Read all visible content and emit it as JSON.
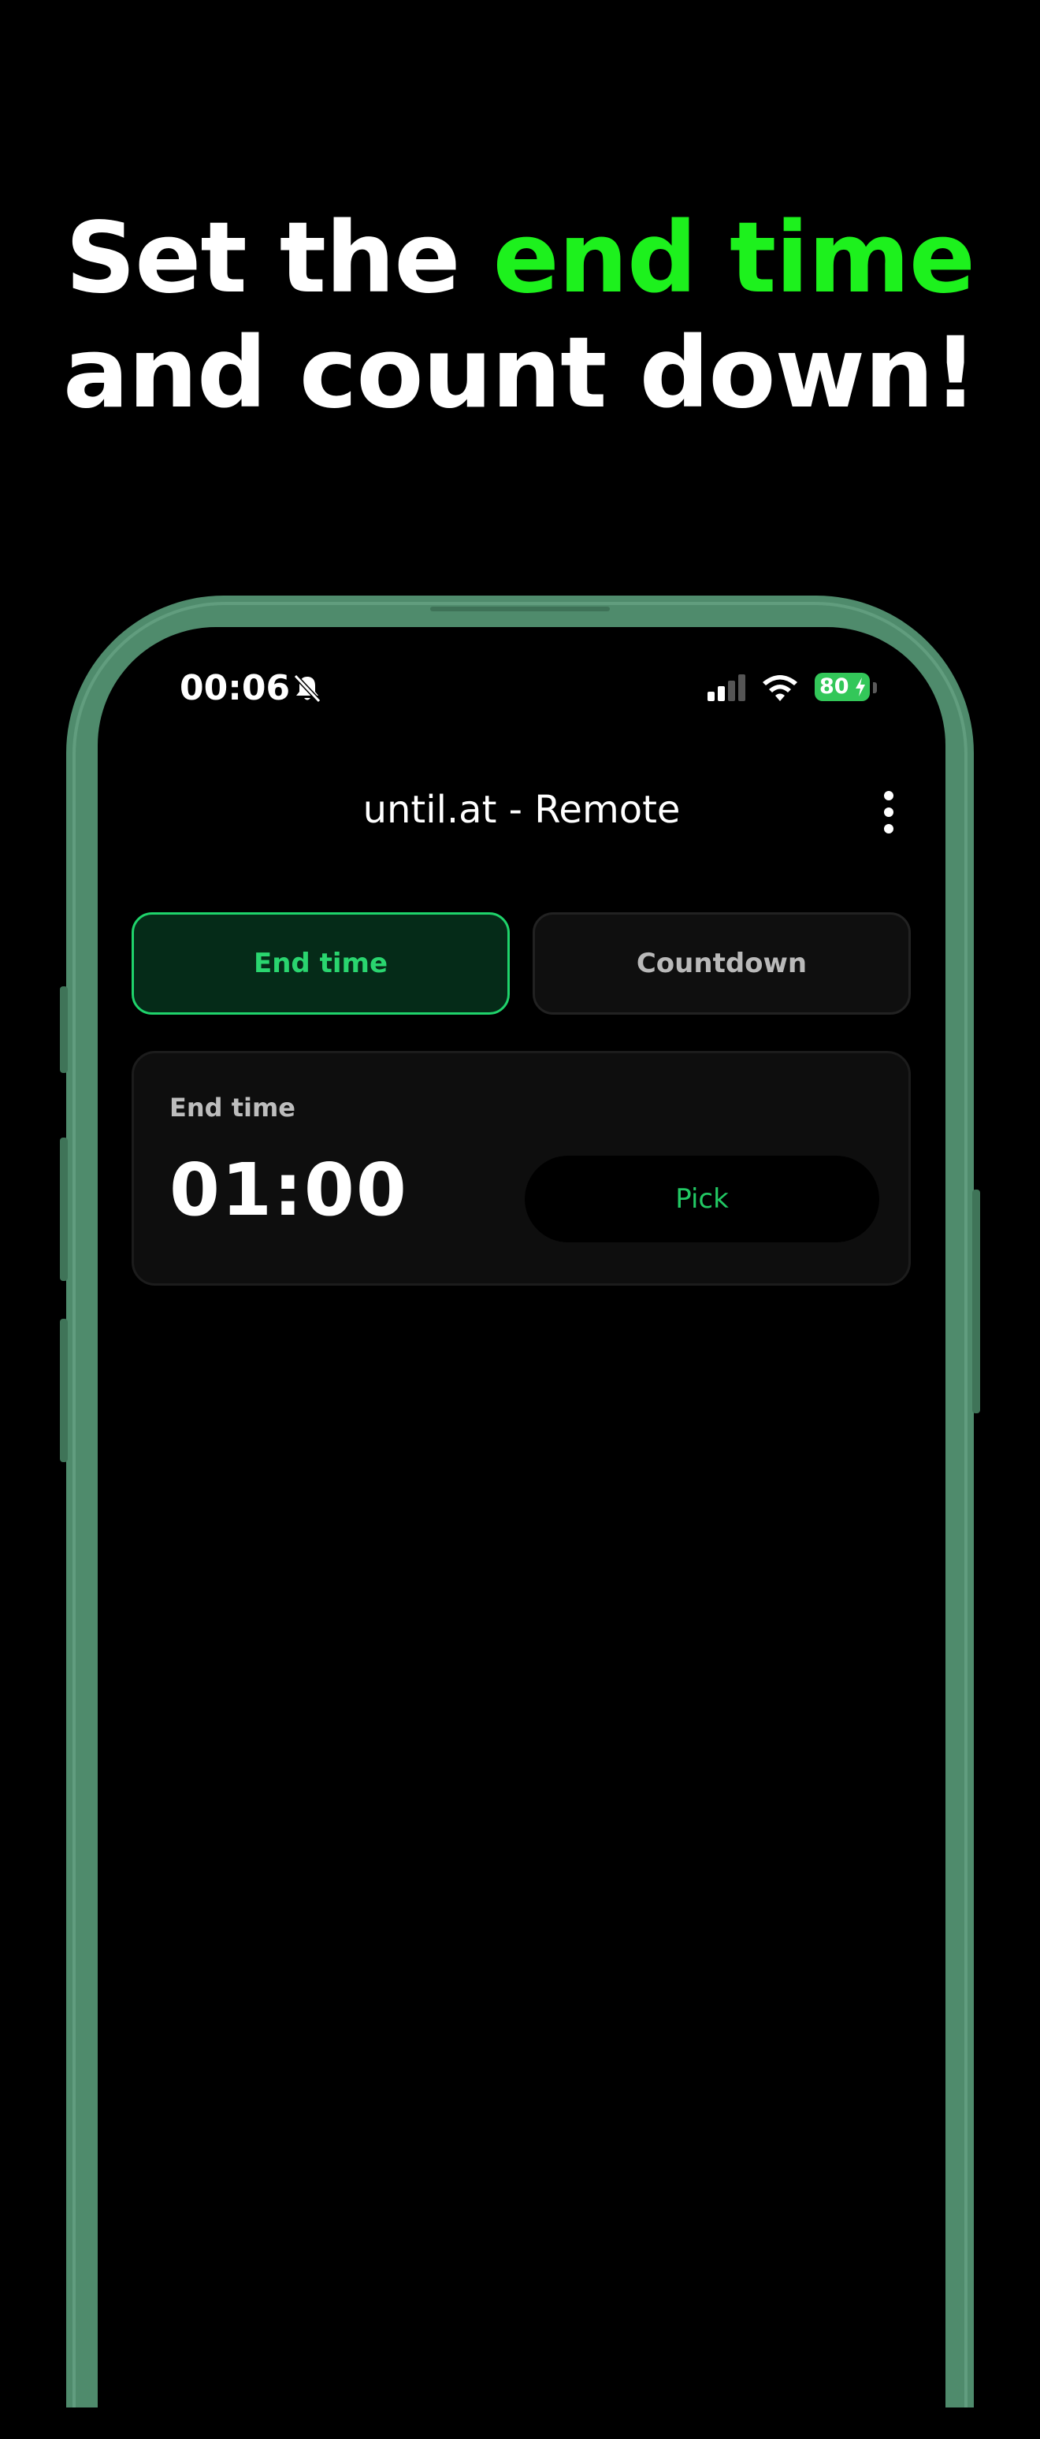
{
  "headline": {
    "part1": "Set the ",
    "accent": "end time",
    "line2": "and count down!",
    "accent_color": "#1df11d"
  },
  "status_bar": {
    "time": "00:06",
    "battery": "80",
    "silent_icon": "bell-slash-icon",
    "signal_icon": "cellular-signal-icon",
    "wifi_icon": "wifi-icon"
  },
  "app": {
    "title": "until.at - Remote",
    "menu_icon": "more-vertical-icon"
  },
  "mode_toggle": {
    "options": [
      {
        "label": "End time",
        "selected": true
      },
      {
        "label": "Countdown",
        "selected": false
      }
    ]
  },
  "end_time_card": {
    "label": "End time",
    "value": "01:00",
    "pick_label": "Pick"
  },
  "colors": {
    "phone_frame": "#4f8b6c",
    "active_green": "#2ad56f",
    "battery_green": "#33c759"
  }
}
